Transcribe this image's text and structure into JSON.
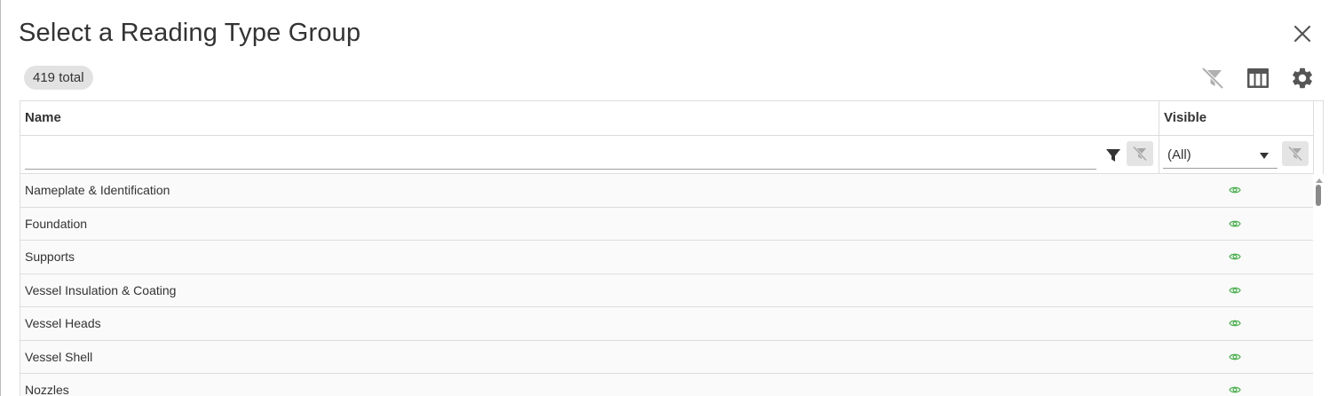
{
  "dialog": {
    "title": "Select a Reading Type Group",
    "total_badge": "419 total"
  },
  "toolbar": {
    "icons": [
      "clear-filters-icon",
      "column-chooser-icon",
      "settings-gear-icon"
    ]
  },
  "grid": {
    "columns": [
      {
        "label": "Name"
      },
      {
        "label": "Visible"
      }
    ],
    "filters": {
      "name_value": "",
      "visible_selected": "(All)"
    },
    "rows": [
      {
        "name": "Nameplate & Identification",
        "visible": true
      },
      {
        "name": "Foundation",
        "visible": true
      },
      {
        "name": "Supports",
        "visible": true
      },
      {
        "name": "Vessel Insulation & Coating",
        "visible": true
      },
      {
        "name": "Vessel Heads",
        "visible": true
      },
      {
        "name": "Vessel Shell",
        "visible": true
      },
      {
        "name": "Nozzles",
        "visible": true
      }
    ]
  },
  "colors": {
    "visible_icon": "#4caf50",
    "icon_dark": "#555555",
    "icon_disabled": "#b0b0b0",
    "badge_bg": "#e2e2e2"
  }
}
